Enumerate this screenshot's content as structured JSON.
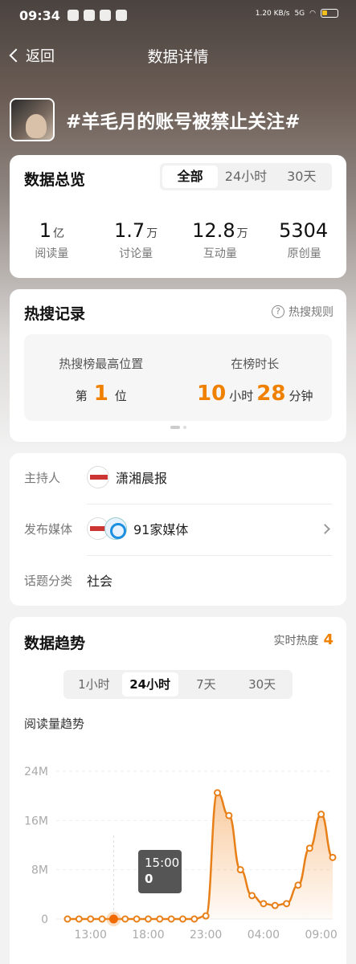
{
  "status": {
    "time": "09:34",
    "net_speed": "1.20 KB/s",
    "signal": "5G"
  },
  "nav": {
    "back_label": "返回",
    "title": "数据详情"
  },
  "topic": {
    "title": "#羊毛月的账号被禁止关注#"
  },
  "overview": {
    "title": "数据总览",
    "tabs": [
      "全部",
      "24小时",
      "30天"
    ],
    "active_tab": "全部",
    "stats": [
      {
        "value": "1",
        "unit": "亿",
        "label": "阅读量"
      },
      {
        "value": "1.7",
        "unit": "万",
        "label": "讨论量"
      },
      {
        "value": "12.8",
        "unit": "万",
        "label": "互动量"
      },
      {
        "value": "5304",
        "unit": "",
        "label": "原创量"
      }
    ]
  },
  "hotsearch": {
    "title": "热搜记录",
    "rules_label": "热搜规则",
    "peak_label": "热搜榜最高位置",
    "peak_prefix": "第",
    "peak_value": "1",
    "peak_suffix": "位",
    "duration_label": "在榜时长",
    "hours": "10",
    "hours_unit": "小时",
    "minutes": "28",
    "minutes_unit": "分钟"
  },
  "info": {
    "host_label": "主持人",
    "host_name": "潇湘晨报",
    "media_label": "发布媒体",
    "media_count": "91家媒体",
    "category_label": "话题分类",
    "category": "社会"
  },
  "trend": {
    "title": "数据趋势",
    "realtime_label": "实时热度",
    "realtime_value": "4",
    "tabs": [
      "1小时",
      "24小时",
      "7天",
      "30天"
    ],
    "active_tab": "24小时",
    "subtitle": "阅读量趋势",
    "tooltip": {
      "time": "15:00",
      "value": "0"
    }
  },
  "colors": {
    "accent": "#f08000",
    "line": "#e8801a"
  },
  "chart_data": {
    "type": "area",
    "title": "阅读量趋势",
    "xlabel": "",
    "ylabel": "",
    "ylim": [
      0,
      24
    ],
    "yticks": [
      "0",
      "8M",
      "16M",
      "24M"
    ],
    "xticks": [
      "13:00",
      "18:00",
      "23:00",
      "04:00",
      "09:00"
    ],
    "x": [
      "11:00",
      "12:00",
      "13:00",
      "14:00",
      "15:00",
      "16:00",
      "17:00",
      "18:00",
      "19:00",
      "20:00",
      "21:00",
      "22:00",
      "23:00",
      "00:00",
      "01:00",
      "02:00",
      "03:00",
      "04:00",
      "05:00",
      "06:00",
      "07:00",
      "08:00",
      "09:00"
    ],
    "series": [
      {
        "values": [
          0,
          0,
          0,
          0,
          0,
          0,
          0,
          0,
          0,
          0,
          0,
          0,
          0.5,
          20.5,
          16.8,
          8,
          3.8,
          2.5,
          2.2,
          2.5,
          5.5,
          11.5,
          17,
          10
        ]
      }
    ],
    "highlight_x": "15:00",
    "grid": true
  }
}
